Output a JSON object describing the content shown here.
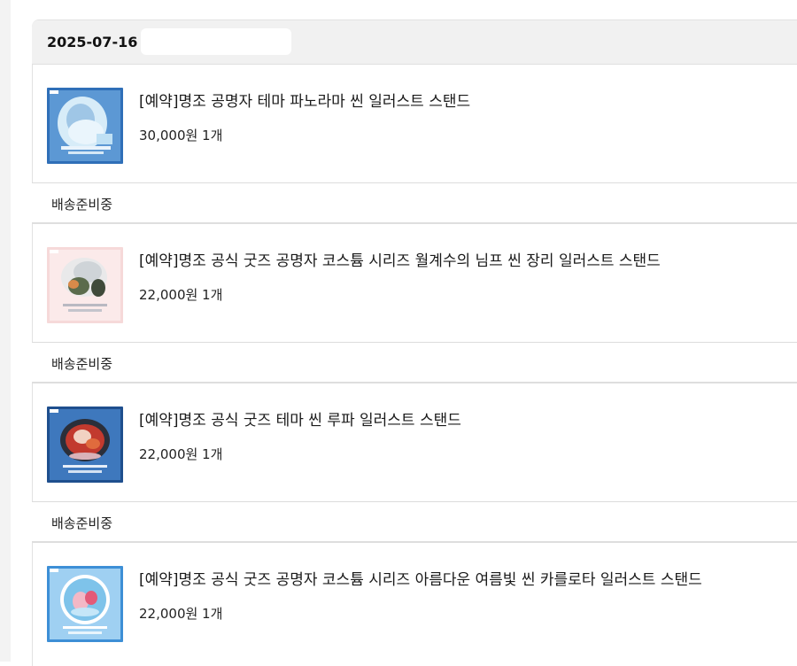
{
  "order": {
    "date": "2025-07-16"
  },
  "items": [
    {
      "title": "[예약]명조 공명자 테마 파노라마 씬 일러스트 스탠드",
      "price_qty": "30,000원 1개",
      "status": "배송준비중",
      "thumb_theme": "blue-ice"
    },
    {
      "title": "[예약]명조 공식 굿즈 공명자 코스튬 시리즈 월계수의 님프 씬 장리 일러스트 스탠드",
      "price_qty": "22,000원 1개",
      "status": "배송준비중",
      "thumb_theme": "pink-nymph"
    },
    {
      "title": "[예약]명조 공식 굿즈 테마 씬 루파 일러스트 스탠드",
      "price_qty": "22,000원 1개",
      "status": "배송준비중",
      "thumb_theme": "red-flame"
    },
    {
      "title": "[예약]명조 공식 굿즈 공명자 코스튬 시리즈 아름다운 여름빛 씬 카를로타 일러스트 스탠드",
      "price_qty": "22,000원 1개",
      "thumb_theme": "summer-blue"
    }
  ],
  "colors": {
    "header_bg": "#f1f1f1",
    "border": "#dedede",
    "text": "#222222"
  }
}
